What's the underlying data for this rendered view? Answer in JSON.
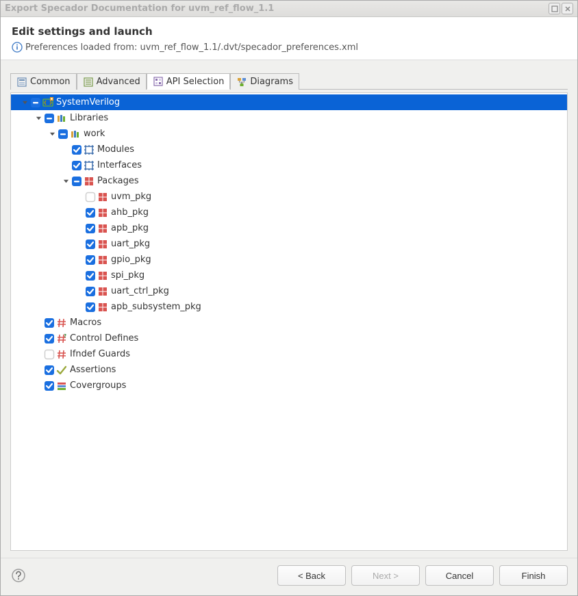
{
  "window": {
    "title": "Export Specador Documentation for uvm_ref_flow_1.1"
  },
  "header": {
    "title": "Edit settings and launch",
    "info": "Preferences loaded from: uvm_ref_flow_1.1/.dvt/specador_preferences.xml"
  },
  "tabs": [
    {
      "label": "Common",
      "active": false
    },
    {
      "label": "Advanced",
      "active": false
    },
    {
      "label": "API Selection",
      "active": true
    },
    {
      "label": "Diagrams",
      "active": false
    }
  ],
  "tree": [
    {
      "depth": 0,
      "expander": "down",
      "check": "minus",
      "icon": "sv",
      "label": "SystemVerilog",
      "selected": true
    },
    {
      "depth": 1,
      "expander": "down",
      "check": "minus",
      "icon": "lib",
      "label": "Libraries"
    },
    {
      "depth": 2,
      "expander": "down",
      "check": "minus",
      "icon": "lib",
      "label": "work"
    },
    {
      "depth": 3,
      "expander": "none",
      "check": "checked",
      "icon": "module",
      "label": "Modules"
    },
    {
      "depth": 3,
      "expander": "none",
      "check": "checked",
      "icon": "module",
      "label": "Interfaces"
    },
    {
      "depth": 3,
      "expander": "down",
      "check": "minus",
      "icon": "pkg",
      "label": "Packages"
    },
    {
      "depth": 4,
      "expander": "none",
      "check": "empty",
      "icon": "pkg",
      "label": "uvm_pkg"
    },
    {
      "depth": 4,
      "expander": "none",
      "check": "checked",
      "icon": "pkg",
      "label": "ahb_pkg"
    },
    {
      "depth": 4,
      "expander": "none",
      "check": "checked",
      "icon": "pkg",
      "label": "apb_pkg"
    },
    {
      "depth": 4,
      "expander": "none",
      "check": "checked",
      "icon": "pkg",
      "label": "uart_pkg"
    },
    {
      "depth": 4,
      "expander": "none",
      "check": "checked",
      "icon": "pkg",
      "label": "gpio_pkg"
    },
    {
      "depth": 4,
      "expander": "none",
      "check": "checked",
      "icon": "pkg",
      "label": "spi_pkg"
    },
    {
      "depth": 4,
      "expander": "none",
      "check": "checked",
      "icon": "pkg",
      "label": "uart_ctrl_pkg"
    },
    {
      "depth": 4,
      "expander": "none",
      "check": "checked",
      "icon": "pkg",
      "label": "apb_subsystem_pkg"
    },
    {
      "depth": 1,
      "expander": "none",
      "check": "checked",
      "icon": "hash",
      "label": "Macros"
    },
    {
      "depth": 1,
      "expander": "none",
      "check": "checked",
      "icon": "hashq",
      "label": "Control Defines"
    },
    {
      "depth": 1,
      "expander": "none",
      "check": "empty",
      "icon": "hash",
      "label": "Ifndef Guards"
    },
    {
      "depth": 1,
      "expander": "none",
      "check": "checked",
      "icon": "assert",
      "label": "Assertions"
    },
    {
      "depth": 1,
      "expander": "none",
      "check": "checked",
      "icon": "cover",
      "label": "Covergroups"
    }
  ],
  "footer": {
    "back": "< Back",
    "next": "Next >",
    "cancel": "Cancel",
    "finish": "Finish"
  }
}
